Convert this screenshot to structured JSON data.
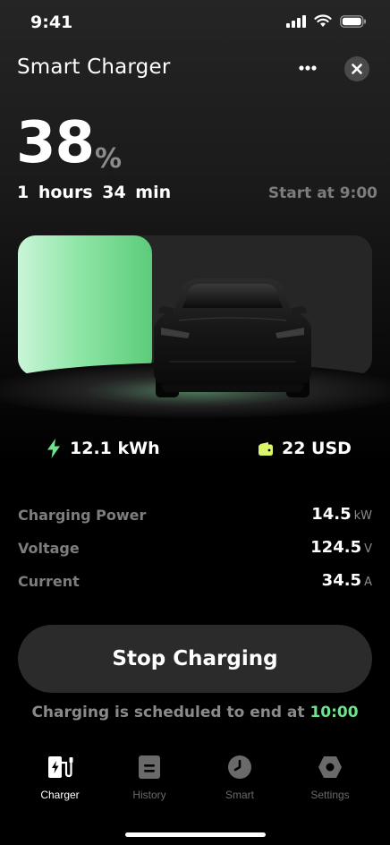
{
  "status_bar": {
    "time": "9:41"
  },
  "header": {
    "title": "Smart Charger"
  },
  "charge": {
    "percent": "38",
    "percent_unit": "%",
    "level": 0.38,
    "remaining": "1 hours  34 min",
    "start_at": "Start at 9:00"
  },
  "energy": {
    "value": "12.1 kWh",
    "icon": "bolt-icon"
  },
  "cost": {
    "value": "22 USD",
    "icon": "wallet-icon"
  },
  "metrics": [
    {
      "label": "Charging Power",
      "value": "14.5",
      "unit": "kW"
    },
    {
      "label": "Voltage",
      "value": "124.5",
      "unit": "V"
    },
    {
      "label": "Current",
      "value": "34.5",
      "unit": "A"
    }
  ],
  "actions": {
    "stop_label": "Stop Charging"
  },
  "schedule": {
    "text": "Charging is scheduled to end at",
    "time": "10:00"
  },
  "tabs": [
    {
      "label": "Charger",
      "icon": "ev-charger-icon",
      "active": true
    },
    {
      "label": "History",
      "icon": "document-icon",
      "active": false
    },
    {
      "label": "Smart",
      "icon": "clock-icon",
      "active": false
    },
    {
      "label": "Settings",
      "icon": "gear-icon",
      "active": false
    }
  ],
  "colors": {
    "background": "#000000",
    "accent_green": "#6ee28d",
    "energy_icon": "#6ee28d",
    "wallet_icon": "#d9f56a",
    "button_bg": "#2b2b2b",
    "muted_text": "#7d7d7d"
  }
}
